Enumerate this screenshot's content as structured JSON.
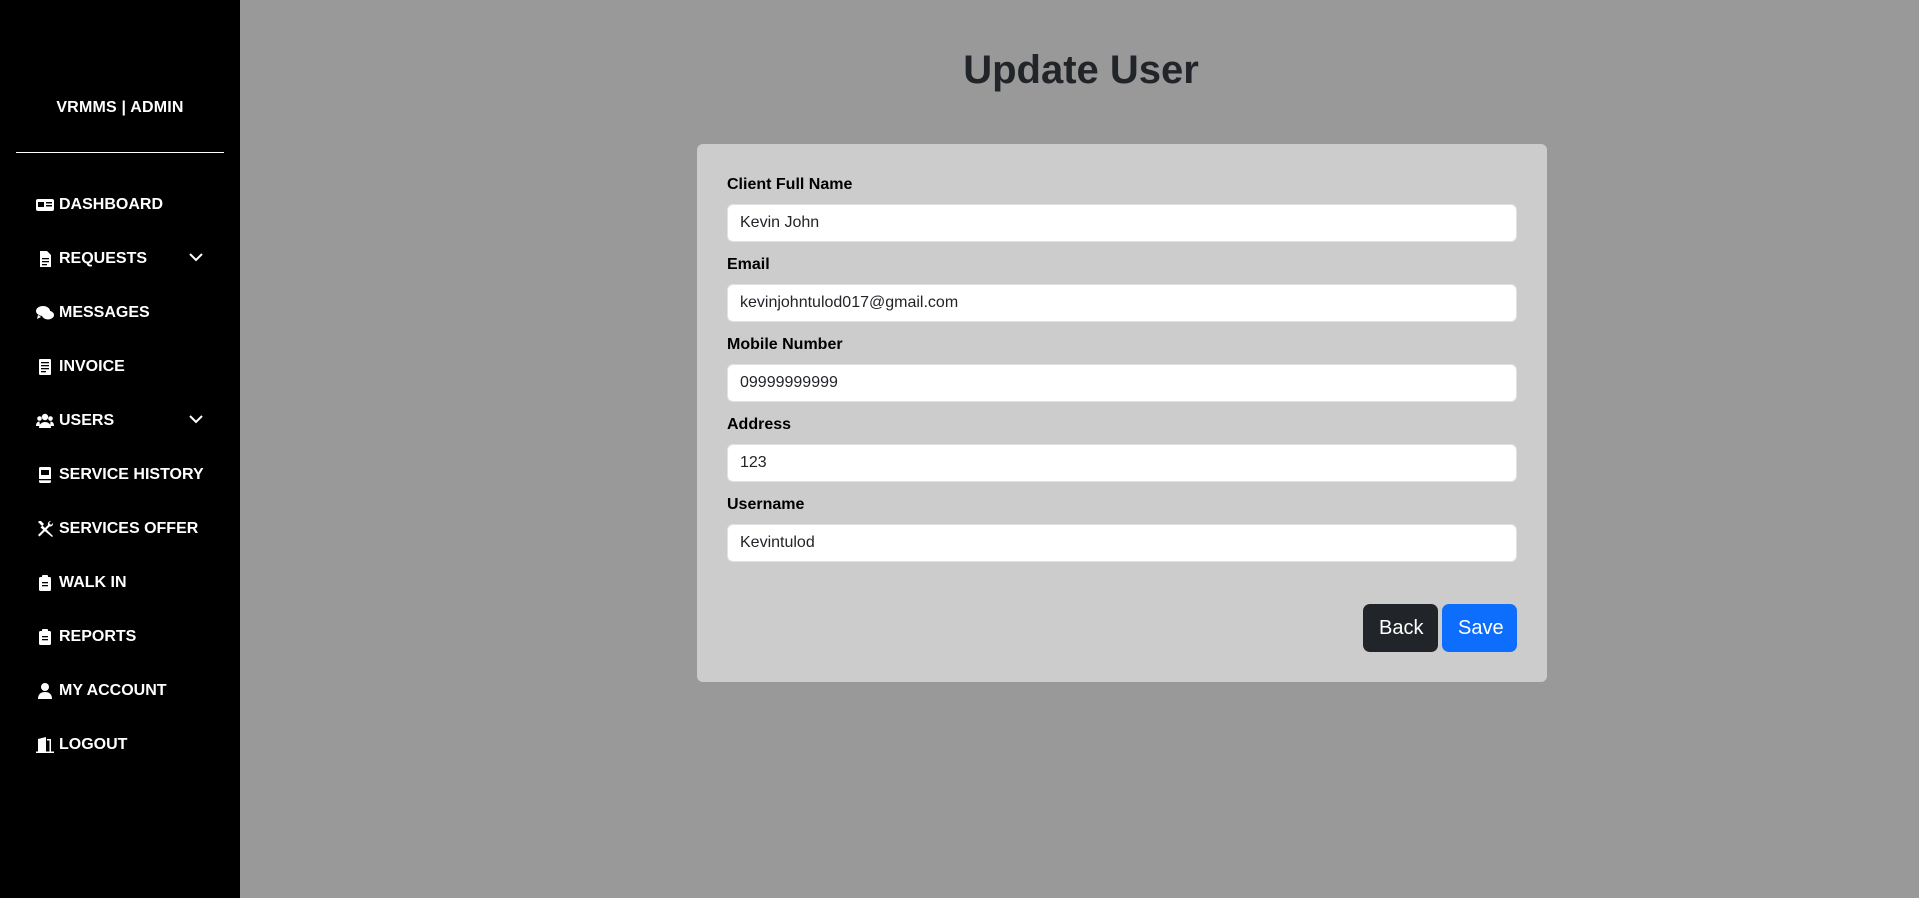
{
  "sidebar": {
    "brand": "VRMMS | ADMIN",
    "items": [
      {
        "label": "DASHBOARD",
        "icon": "dashboard-icon",
        "dropdown": false
      },
      {
        "label": "REQUESTS",
        "icon": "file-icon",
        "dropdown": true
      },
      {
        "label": "MESSAGES",
        "icon": "chat-icon",
        "dropdown": false
      },
      {
        "label": "INVOICE",
        "icon": "receipt-icon",
        "dropdown": false
      },
      {
        "label": "USERS",
        "icon": "users-icon",
        "dropdown": true
      },
      {
        "label": "SERVICE HISTORY",
        "icon": "book-icon",
        "dropdown": false
      },
      {
        "label": "SERVICES OFFER",
        "icon": "tools-icon",
        "dropdown": false
      },
      {
        "label": "WALK IN",
        "icon": "clipboard-icon",
        "dropdown": false
      },
      {
        "label": "REPORTS",
        "icon": "clipboard-icon",
        "dropdown": false
      },
      {
        "label": "MY ACCOUNT",
        "icon": "user-icon",
        "dropdown": false
      },
      {
        "label": "LOGOUT",
        "icon": "door-icon",
        "dropdown": false
      }
    ]
  },
  "main": {
    "title": "Update User",
    "form": {
      "full_name": {
        "label": "Client Full Name",
        "value": "Kevin John"
      },
      "email": {
        "label": "Email",
        "value": "kevinjohntulod017@gmail.com"
      },
      "mobile": {
        "label": "Mobile Number",
        "value": "09999999999"
      },
      "address": {
        "label": "Address",
        "value": "123"
      },
      "username": {
        "label": "Username",
        "value": "Kevintulod"
      }
    },
    "back_label": "Back",
    "save_label": "Save"
  },
  "colors": {
    "sidebar_bg": "#000000",
    "page_bg": "#999999",
    "card_bg": "#cccccc",
    "back_button": "#212529",
    "save_button": "#0d6efd"
  }
}
